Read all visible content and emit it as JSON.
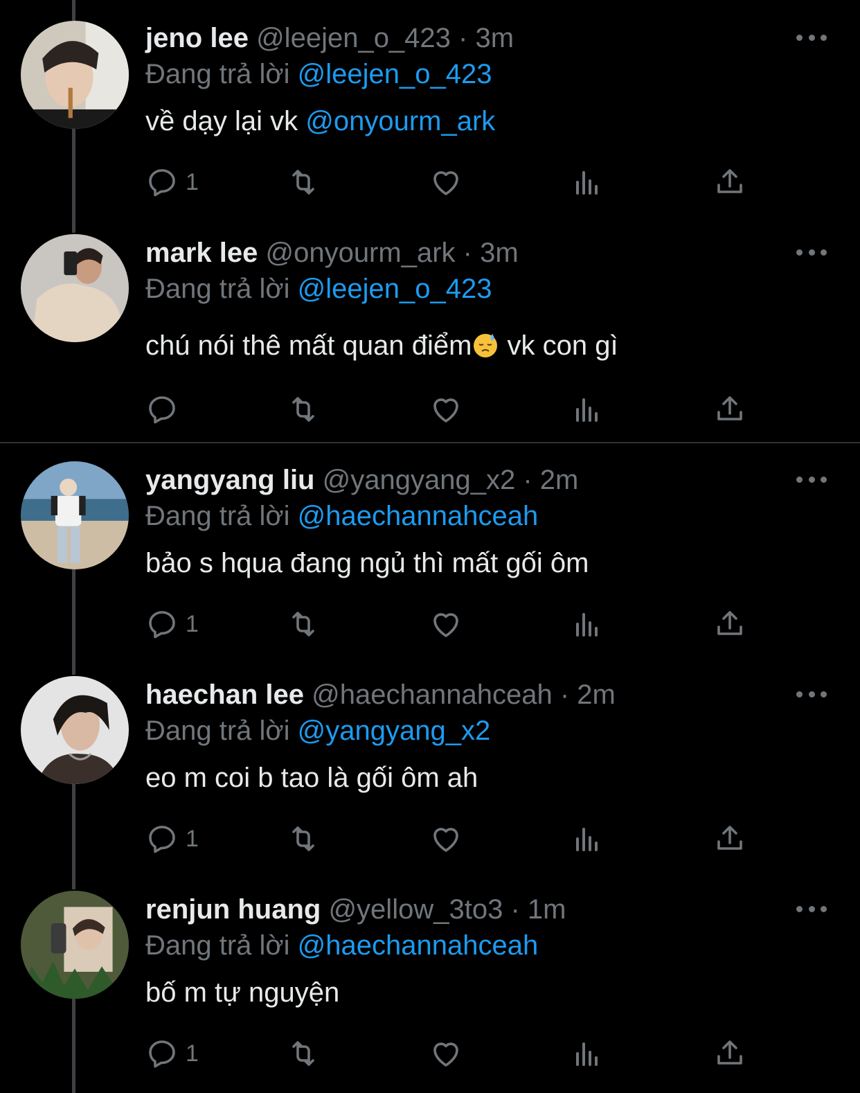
{
  "tweets": [
    {
      "name": "jeno lee",
      "handle": "@leejen_o_423",
      "time": "3m",
      "replying_prefix": "Đang trả lời",
      "replying_to": "@leejen_o_423",
      "text": "về dạy lại vk",
      "text_mention": "@onyourm_ark",
      "reply_count": "1"
    },
    {
      "name": "mark lee",
      "handle": "@onyourm_ark",
      "time": "3m",
      "replying_prefix": "Đang trả lời",
      "replying_to": "@leejen_o_423",
      "text_before": "chú nói thê mất quan điểm",
      "text_after": " vk con gì",
      "emoji": "downcast-face-with-sweat"
    },
    {
      "name": "yangyang liu",
      "handle": "@yangyang_x2",
      "time": "2m",
      "replying_prefix": "Đang trả lời",
      "replying_to": "@haechannahceah",
      "text": "bảo s hqua đang ngủ thì mất gối ôm",
      "reply_count": "1"
    },
    {
      "name": "haechan lee",
      "handle": "@haechannahceah",
      "time": "2m",
      "replying_prefix": "Đang trả lời",
      "replying_to": "@yangyang_x2",
      "text": "eo m coi b tao là gối ôm ah",
      "reply_count": "1"
    },
    {
      "name": "renjun huang",
      "handle": "@yellow_3to3",
      "time": "1m",
      "replying_prefix": "Đang trả lời",
      "replying_to": "@haechannahceah",
      "text": "bố m tự nguyện",
      "reply_count": "1"
    }
  ],
  "separator": "·",
  "icons": [
    "reply-icon",
    "retweet-icon",
    "like-icon",
    "views-icon",
    "share-icon",
    "more-icon"
  ],
  "colors": {
    "background": "#000000",
    "text": "#e7e9ea",
    "muted": "#71767b",
    "mention": "#1d9bf0",
    "rail": "#3e4144"
  }
}
